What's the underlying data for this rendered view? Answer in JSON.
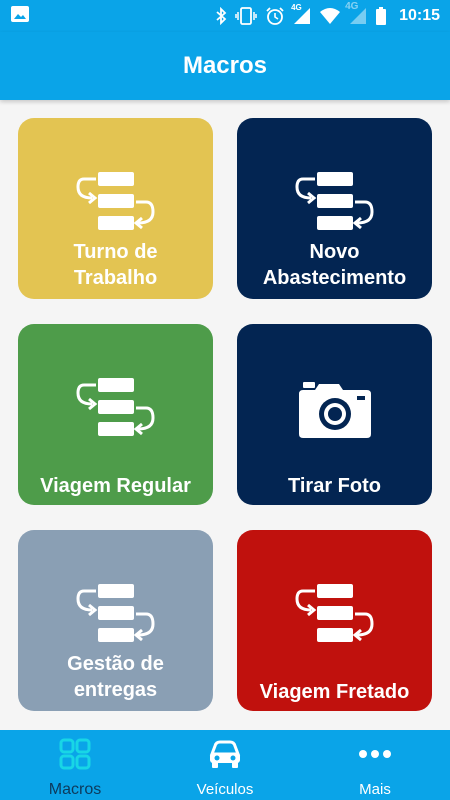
{
  "status_bar": {
    "network_label_1": "4G",
    "network_label_2": "4G",
    "time": "10:15",
    "icons": [
      "image-icon",
      "bluetooth-icon",
      "vibrate-icon",
      "alarm-icon",
      "signal-icon",
      "wifi-icon",
      "signal-icon",
      "battery-icon"
    ]
  },
  "app_bar": {
    "title": "Macros"
  },
  "tiles": [
    {
      "label": "Turno de\nTrabalho",
      "color": "#e3c452",
      "icon": "macro-flow-icon"
    },
    {
      "label": "Novo\nAbastecimento",
      "color": "#032552",
      "icon": "macro-flow-icon"
    },
    {
      "label": "Viagem Regular",
      "color": "#4e9c4a",
      "icon": "macro-flow-icon"
    },
    {
      "label": "Tirar Foto",
      "color": "#032552",
      "icon": "camera-icon"
    },
    {
      "label": "Gestão de\nentregas",
      "color": "#8a9fb4",
      "icon": "macro-flow-icon"
    },
    {
      "label": "Viagem Fretado",
      "color": "#c0110d",
      "icon": "macro-flow-icon"
    }
  ],
  "bottom_nav": {
    "items": [
      {
        "label": "Macros",
        "icon": "grid-icon",
        "active": true
      },
      {
        "label": "Veículos",
        "icon": "car-icon",
        "active": false
      },
      {
        "label": "Mais",
        "icon": "more-dots-icon",
        "active": false
      }
    ]
  },
  "colors": {
    "primary": "#0aa4e8",
    "active_nav_icon": "#18d6e6",
    "active_nav_label": "#0d3a5c",
    "background": "#f5f5f5"
  }
}
